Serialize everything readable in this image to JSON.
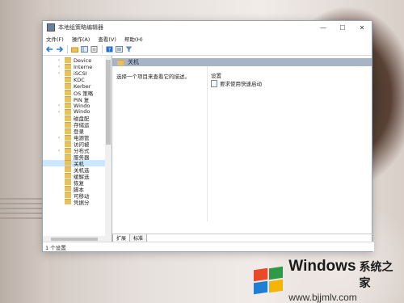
{
  "window": {
    "title": "本地组策略编辑器",
    "controls": {
      "minimize": "—",
      "maximize": "☐",
      "close": "✕"
    }
  },
  "menu": [
    "文件(F)",
    "操作(A)",
    "查看(V)",
    "帮助(H)"
  ],
  "toolbar": {
    "icons": [
      "back-arrow-icon",
      "forward-arrow-icon",
      "up-folder-icon",
      "show-tree-icon",
      "properties-icon",
      "help-icon",
      "filter-icon"
    ]
  },
  "tree": {
    "items": [
      {
        "label": "Device",
        "expander": "›"
      },
      {
        "label": "Interne",
        "expander": "›"
      },
      {
        "label": "iSCSI",
        "expander": "›"
      },
      {
        "label": "KDC",
        "expander": ""
      },
      {
        "label": "Kerber",
        "expander": ""
      },
      {
        "label": "OS 策略",
        "expander": ""
      },
      {
        "label": "PIN 复",
        "expander": ""
      },
      {
        "label": "Windo",
        "expander": "›"
      },
      {
        "label": "Windo",
        "expander": "›"
      },
      {
        "label": "磁盘配",
        "expander": ""
      },
      {
        "label": "存储运",
        "expander": ""
      },
      {
        "label": "登录",
        "expander": ""
      },
      {
        "label": "电源管",
        "expander": "›"
      },
      {
        "label": "访问被",
        "expander": ""
      },
      {
        "label": "分布式",
        "expander": "›"
      },
      {
        "label": "服务器",
        "expander": ""
      },
      {
        "label": "关机",
        "expander": "",
        "selected": true
      },
      {
        "label": "关机选",
        "expander": ""
      },
      {
        "label": "缓解选",
        "expander": ""
      },
      {
        "label": "恢复",
        "expander": ""
      },
      {
        "label": "脚本",
        "expander": ""
      },
      {
        "label": "可移动",
        "expander": ""
      },
      {
        "label": "凭据分",
        "expander": ""
      }
    ]
  },
  "main": {
    "folder_title": "关机",
    "description": "选择一个项目来查看它的描述。",
    "settings_header": "设置",
    "settings": [
      {
        "label": "要求使用快速启动"
      }
    ]
  },
  "tabs": [
    "扩展",
    "标准"
  ],
  "status": "1 个设置",
  "watermark": {
    "brand": "Windows",
    "cn": "系统之家",
    "url": "www.bjjmlv.com"
  },
  "colors": {
    "folder": "#e8c15a",
    "header_bar": "#a6b4c6",
    "selected": "#cce8ff",
    "logo": [
      "#e94b2a",
      "#2d9a45",
      "#1f7fd4",
      "#f4b400"
    ]
  }
}
